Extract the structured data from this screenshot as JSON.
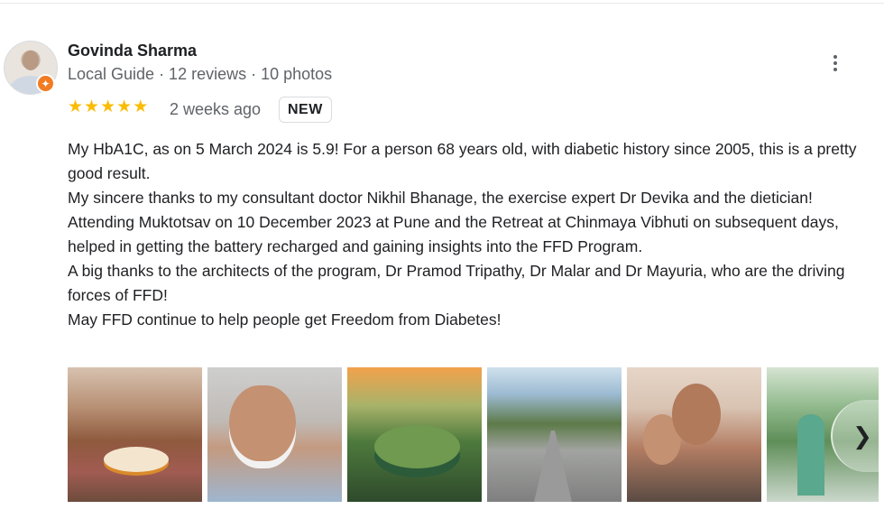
{
  "reviewer": {
    "name": "Govinda Sharma",
    "meta": "Local Guide · 12 reviews · 10 photos",
    "avatar_icon": "user-avatar",
    "badge_icon": "local-guide-star"
  },
  "rating": {
    "stars": 5,
    "max": 5,
    "star_symbols": [
      "★",
      "★",
      "★",
      "★",
      "★"
    ],
    "date": "2 weeks ago",
    "badge": "NEW"
  },
  "review": {
    "paragraphs": [
      "My HbA1C, as on 5 March 2024 is 5.9! For a person 68 years old, with diabetic history since 2005, this is a pretty good result.",
      "My sincere thanks to my consultant doctor Nikhil Bhanage, the exercise expert Dr Devika and the dietician!",
      "Attending Muktotsav on 10 December 2023 at Pune and the Retreat at Chinmaya Vibhuti on subsequent days,  helped in getting the battery recharged and gaining insights into the FFD Program.",
      "A big thanks to the architects of the program, Dr Pramod Tripathy, Dr Malar and Dr Mayuria, who are the driving forces of FFD!",
      "May FFD continue to help people get Freedom from Diabetes!"
    ]
  },
  "photos": {
    "count_visible": 6,
    "next_glyph": "❯",
    "next_icon": "chevron-right-icon"
  },
  "colors": {
    "star": "#fbbc04",
    "guide_badge": "#f27c22",
    "text_primary": "#202124",
    "text_secondary": "#5f6368"
  }
}
